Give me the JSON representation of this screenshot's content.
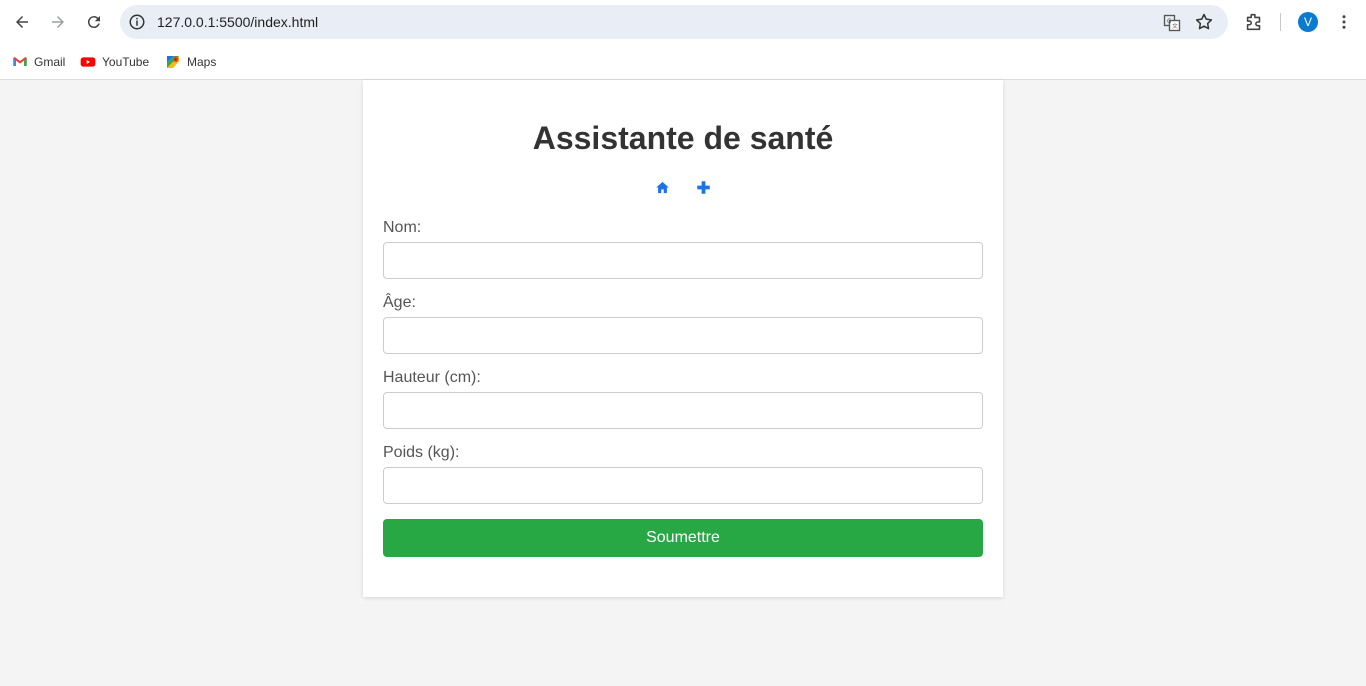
{
  "browser": {
    "url": "127.0.0.1:5500/index.html",
    "profile_initial": "V",
    "bookmarks": [
      {
        "label": "Gmail",
        "icon": "gmail-icon"
      },
      {
        "label": "YouTube",
        "icon": "youtube-icon"
      },
      {
        "label": "Maps",
        "icon": "maps-icon"
      }
    ]
  },
  "page": {
    "title": "Assistante de santé",
    "nav_icons": [
      "home-icon",
      "plus-icon"
    ],
    "form": {
      "fields": [
        {
          "label": "Nom:",
          "value": ""
        },
        {
          "label": "Âge:",
          "value": ""
        },
        {
          "label": "Hauteur (cm):",
          "value": ""
        },
        {
          "label": "Poids (kg):",
          "value": ""
        }
      ],
      "submit_label": "Soumettre"
    }
  },
  "colors": {
    "accent_blue": "#1a73e8",
    "submit_green": "#28a745",
    "page_bg": "#f4f4f4"
  }
}
